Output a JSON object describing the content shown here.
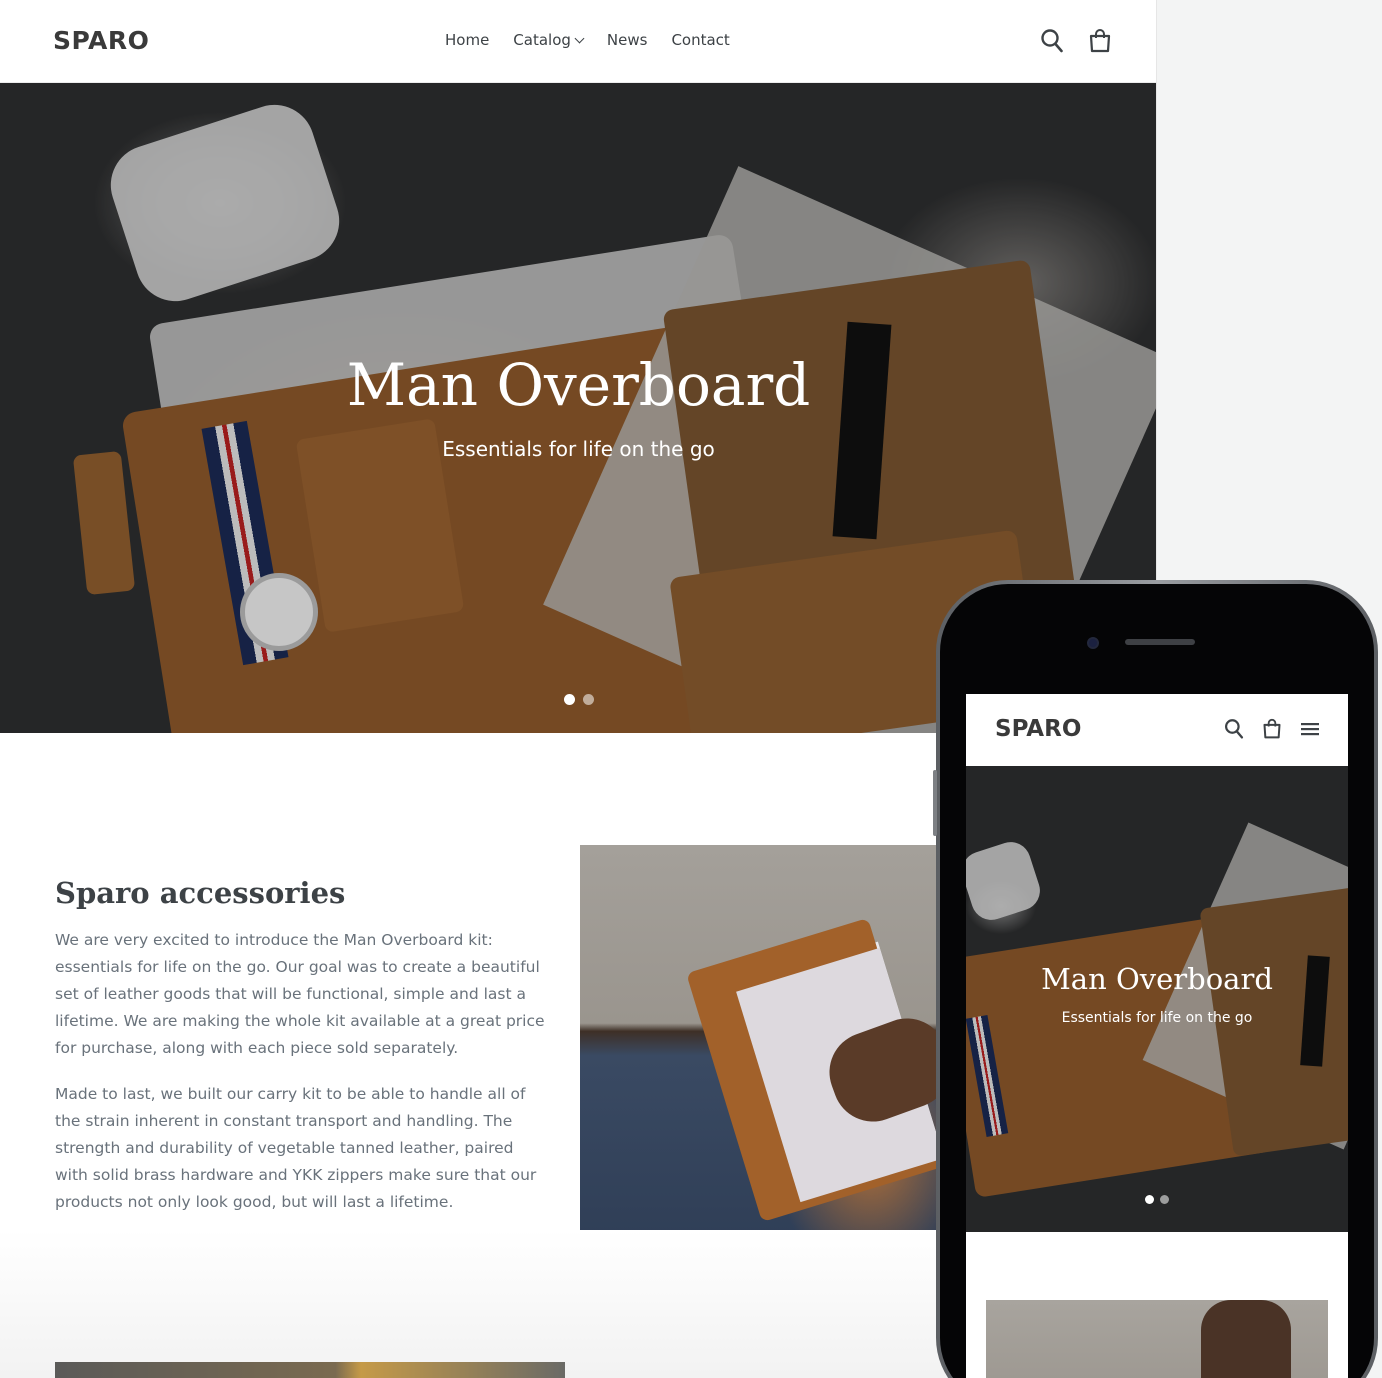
{
  "desktop": {
    "header": {
      "logo": "SPARO",
      "nav": [
        {
          "label": "Home"
        },
        {
          "label": "Catalog"
        },
        {
          "label": "News"
        },
        {
          "label": "Contact"
        }
      ]
    },
    "hero": {
      "title": "Man Overboard",
      "subtitle": "Essentials for life on the go",
      "slides": 2,
      "active_slide": 1
    },
    "about": {
      "title": "Sparo accessories",
      "paragraph1": "We are very excited to introduce the Man Overboard kit: essentials for life on the go. Our goal was to create a beautiful set of leather goods that will be functional, simple and last a lifetime. We are making the whole kit available at a great price for purchase, along with each piece sold separately.",
      "paragraph2": "Made to last, we built our carry kit to be able to handle all of the strain inherent in constant transport and handling. The strength and durability of vegetable tanned leather, paired with solid brass hardware and YKK zippers make sure that our products not only look good, but will last a lifetime."
    }
  },
  "mobile": {
    "header": {
      "logo": "SPARO"
    },
    "hero": {
      "title": "Man Overboard",
      "subtitle": "Essentials for life on the go",
      "slides": 2,
      "active_slide": 1
    }
  },
  "icons": {
    "search": "search-icon",
    "cart": "cart-icon",
    "menu": "hamburger-menu-icon",
    "dropdown": "chevron-down-icon"
  },
  "colors": {
    "text_dark": "#3d4246",
    "text_body": "#69727b",
    "hero_bg": "#2e2f30",
    "leather": "#96602d"
  }
}
